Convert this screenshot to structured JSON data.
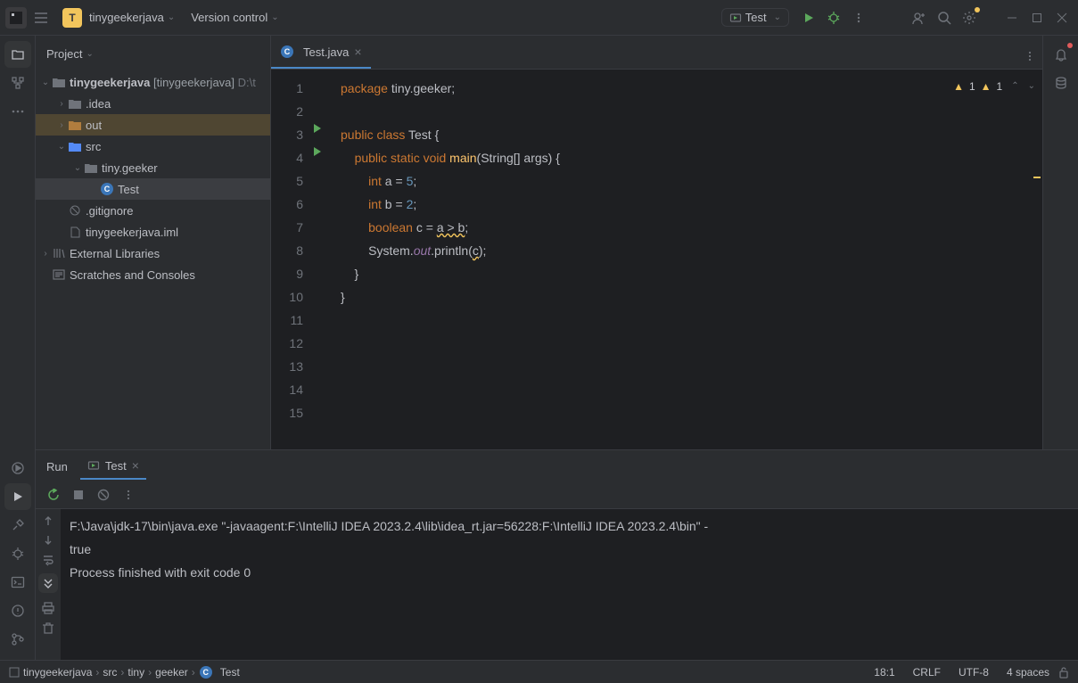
{
  "titlebar": {
    "project_initial": "T",
    "project_name": "tinygeekerjava",
    "menu_vc": "Version control",
    "run_config": "Test"
  },
  "left_tools": [
    "project",
    "structure",
    "more",
    "services",
    "run",
    "build",
    "debug",
    "terminal",
    "problems",
    "git"
  ],
  "project": {
    "title": "Project",
    "tree": {
      "root_name": "tinygeekerjava",
      "root_tag": "[tinygeekerjava]",
      "root_path": "D:\\t",
      "idea": ".idea",
      "out": "out",
      "src": "src",
      "pkg": "tiny.geeker",
      "cls": "Test",
      "gitignore": ".gitignore",
      "iml": "tinygeekerjava.iml",
      "ext": "External Libraries",
      "scratch": "Scratches and Consoles"
    }
  },
  "editor": {
    "tab_file": "Test.java",
    "inspections": {
      "warn1": "1",
      "warn2": "1"
    },
    "lines": {
      "count": 15,
      "l1": {
        "kw": "package",
        "rest": " tiny.geeker;"
      },
      "l3": {
        "a": "public class",
        "b": " Test {"
      },
      "l4": {
        "a": "public static void",
        "fn": "main",
        "c": "(String[] args) {"
      },
      "l5": {
        "a": "int",
        "b": " a = ",
        "n": "5",
        "c": ";"
      },
      "l6": {
        "a": "int",
        "b": " b = ",
        "n": "2",
        "c": ";"
      },
      "l7": {
        "a": "boolean",
        "b": " c = ",
        "expr": "a > b",
        "c": ";"
      },
      "l8": {
        "a": "System.",
        "f": "out",
        "b": ".println(",
        "arg": "c",
        "c": ");"
      },
      "l9": "    }",
      "l10": "}"
    }
  },
  "run": {
    "title": "Run",
    "tab": "Test",
    "console_line1": "F:\\Java\\jdk-17\\bin\\java.exe \"-javaagent:F:\\IntelliJ IDEA 2023.2.4\\lib\\idea_rt.jar=56228:F:\\IntelliJ IDEA 2023.2.4\\bin\" -",
    "console_line2": "true",
    "console_line3": "",
    "console_line4": "Process finished with exit code 0"
  },
  "status": {
    "crumb1": "tinygeekerjava",
    "crumb2": "src",
    "crumb3": "tiny",
    "crumb4": "geeker",
    "crumb5": "Test",
    "pos": "18:1",
    "eol": "CRLF",
    "enc": "UTF-8",
    "indent": "4 spaces"
  }
}
